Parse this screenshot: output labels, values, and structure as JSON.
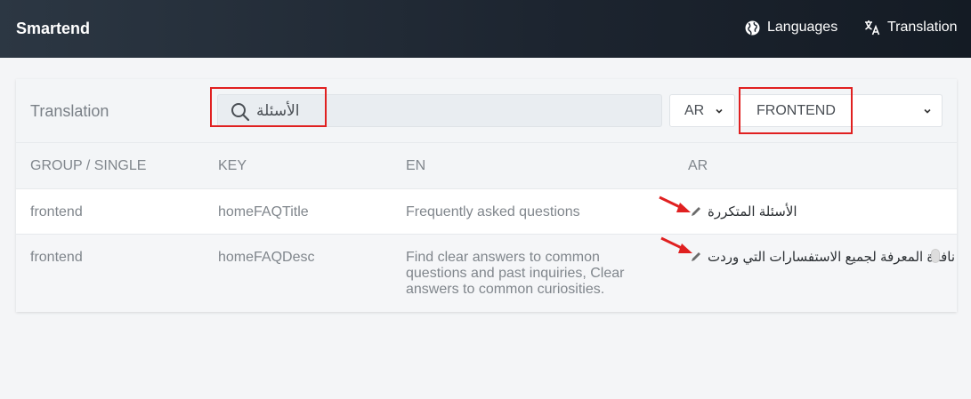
{
  "header": {
    "brand": "Smartend",
    "nav_languages": "Languages",
    "nav_translation": "Translation"
  },
  "panel": {
    "title": "Translation",
    "search_value": "الأسئلة",
    "lang_select": "AR",
    "group_select": "FRONTEND"
  },
  "table": {
    "columns": [
      "GROUP / SINGLE",
      "KEY",
      "EN",
      "AR"
    ],
    "rows": [
      {
        "group": "frontend",
        "key": "homeFAQTitle",
        "en": "Frequently asked questions",
        "ar": "الأسئلة المتكررة"
      },
      {
        "group": "frontend",
        "key": "homeFAQDesc",
        "en": "Find clear answers to common questions and past inquiries, Clear answers to common curiosities.",
        "ar": "نافذة المعرفة لجميع الاستفسارات التي وردت"
      }
    ]
  },
  "colors": {
    "header_bg": "#1d2530",
    "highlight": "#e02020",
    "arrow": "#e02020"
  }
}
